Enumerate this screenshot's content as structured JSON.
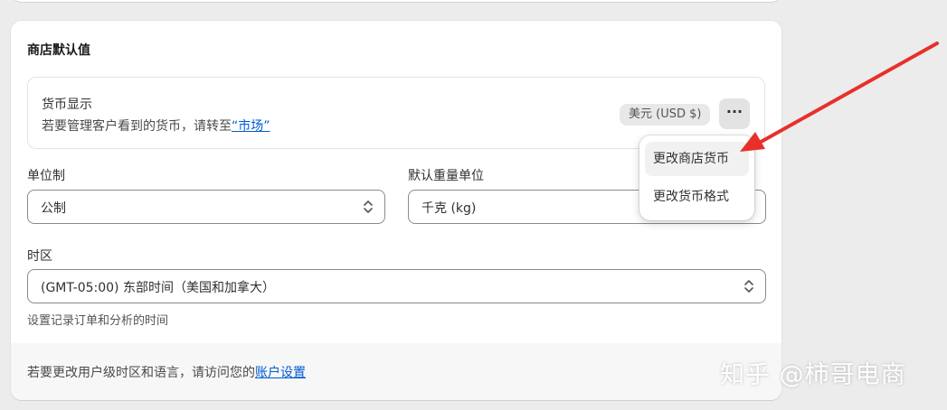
{
  "store_defaults": {
    "title": "商店默认值",
    "currency": {
      "title": "货币显示",
      "description_prefix": "若要管理客户看到的货币，请转至",
      "link_text": "“市场”",
      "badge": "美元 (USD $)",
      "more_button_icon": "ellipsis-icon"
    },
    "unit_system": {
      "label": "单位制",
      "value": "公制"
    },
    "weight_unit": {
      "label": "默认重量单位",
      "value": "千克 (kg)"
    },
    "timezone": {
      "label": "时区",
      "value": "(GMT-05:00) 东部时间（美国和加拿大）",
      "help": "设置记录订单和分析的时间"
    },
    "footer": {
      "text_prefix": "若要更改用户级时区和语言，请访问您的",
      "link_text": "账户设置"
    }
  },
  "currency_menu": {
    "items": [
      {
        "label": "更改商店货币"
      },
      {
        "label": "更改货币格式"
      }
    ]
  },
  "annotation": {
    "arrow_color": "#e8302a"
  },
  "watermark": "知乎 @柿哥电商"
}
